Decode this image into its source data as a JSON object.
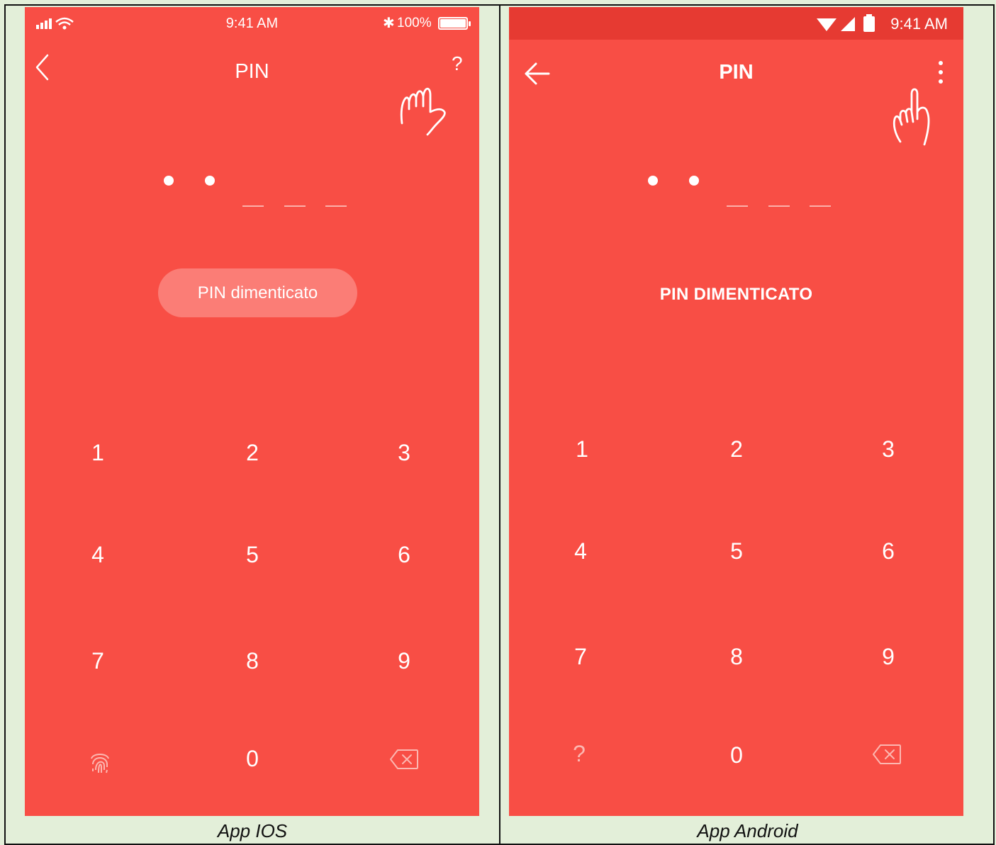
{
  "ios": {
    "status": {
      "time": "9:41 AM",
      "battery": "100%"
    },
    "title": "PIN",
    "help_label": "?",
    "forgot_label": "PIN dimenticato",
    "pin": {
      "length": 5,
      "entered": 2
    },
    "keys": [
      "1",
      "2",
      "3",
      "4",
      "5",
      "6",
      "7",
      "8",
      "9",
      "0"
    ],
    "caption": "App IOS"
  },
  "android": {
    "status": {
      "time": "9:41 AM"
    },
    "title": "PIN",
    "forgot_label": "PIN DIMENTICATO",
    "pin": {
      "length": 5,
      "entered": 2
    },
    "keys": [
      "1",
      "2",
      "3",
      "4",
      "5",
      "6",
      "7",
      "8",
      "9",
      "0"
    ],
    "help_key": "?",
    "caption": "App Android"
  },
  "colors": {
    "accent": "#f84e45",
    "status_android": "#e63a32",
    "forgot_ios_bg": "#fb7d76",
    "page_bg": "#e3efd9"
  },
  "icons": [
    "back-chevron-icon",
    "back-arrow-icon",
    "overflow-menu-icon",
    "hand-tap-icon",
    "fingerprint-icon",
    "backspace-icon",
    "wifi-icon",
    "cellular-icon",
    "battery-icon",
    "bluetooth-icon"
  ]
}
